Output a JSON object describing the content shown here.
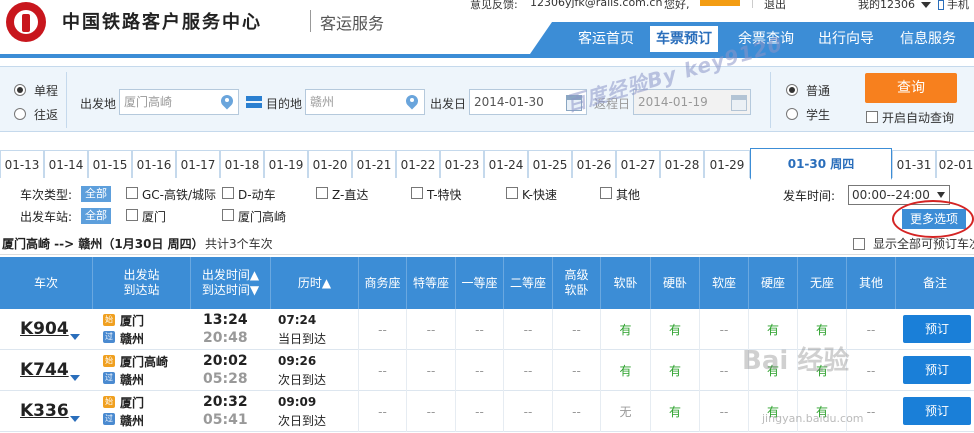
{
  "header": {
    "site_title": "中国铁路客户服务中心",
    "site_sub": "客运服务",
    "feedback": "意见反馈:",
    "feedback_email": "12306yjfk@rails.com.cn",
    "hello": "您好,",
    "logout": "退出",
    "my12306": "我的12306",
    "mobile": "手机"
  },
  "nav": [
    "客运首页",
    "车票预订",
    "余票查询",
    "出行向导",
    "信息服务"
  ],
  "search": {
    "one_way": "单程",
    "round_trip": "往返",
    "from_label": "出发地",
    "from_value": "厦门高崎",
    "to_label": "目的地",
    "to_value": "赣州",
    "date_label": "出发日",
    "date_value": "2014-01-30",
    "return_label": "返程日",
    "return_value": "2014-01-19",
    "normal": "普通",
    "student": "学生",
    "query": "查询",
    "auto_query": "开启自动查询"
  },
  "watermark": "百度经验By key9120",
  "dates": [
    "01-13",
    "01-14",
    "01-15",
    "01-16",
    "01-17",
    "01-18",
    "01-19",
    "01-20",
    "01-21",
    "01-22",
    "01-23",
    "01-24",
    "01-25",
    "01-26",
    "01-27",
    "01-28",
    "01-29",
    "01-30 周四",
    "01-31",
    "02-01"
  ],
  "filters": {
    "type_label": "车次类型:",
    "all": "全部",
    "types": [
      "GC-高铁/城际",
      "D-动车",
      "Z-直达",
      "T-特快",
      "K-快速",
      "其他"
    ],
    "station_label": "出发车站:",
    "stations": [
      "厦门",
      "厦门高崎"
    ],
    "depart_time_label": "发车时间:",
    "depart_time_value": "00:00--24:00",
    "more": "更多选项"
  },
  "route": {
    "text": "厦门高崎 --> 赣州（1月30日 周四）",
    "count": "共计3个车次",
    "show_all": "显示全部可预订车次"
  },
  "table": {
    "headers": [
      "车次",
      "出发站\n到达站",
      "出发时间▲\n到达时间▼",
      "历时▲",
      "商务座",
      "特等座",
      "一等座",
      "二等座",
      "高级\n软卧",
      "软卧",
      "硬卧",
      "软座",
      "硬座",
      "无座",
      "其他",
      "备注"
    ],
    "rows": [
      {
        "train": "K904",
        "from": "厦门",
        "to": "赣州",
        "dep": "13:24",
        "arr": "20:48",
        "dur": "07:24",
        "day": "当日到达",
        "seats": [
          "--",
          "--",
          "--",
          "--",
          "--",
          "有",
          "有",
          "--",
          "有",
          "有",
          "--"
        ],
        "book": "预订"
      },
      {
        "train": "K744",
        "from": "厦门高崎",
        "to": "赣州",
        "dep": "20:02",
        "arr": "05:28",
        "dur": "09:26",
        "day": "次日到达",
        "seats": [
          "--",
          "--",
          "--",
          "--",
          "--",
          "有",
          "有",
          "--",
          "有",
          "有",
          "--"
        ],
        "book": "预订"
      },
      {
        "train": "K336",
        "from": "厦门",
        "to": "赣州",
        "dep": "20:32",
        "arr": "05:41",
        "dur": "09:09",
        "day": "次日到达",
        "seats": [
          "--",
          "--",
          "--",
          "--",
          "--",
          "无",
          "有",
          "--",
          "有",
          "有",
          "--"
        ],
        "book": "预订"
      }
    ],
    "from_tag": "始",
    "to_tag": "过"
  },
  "baidu": {
    "mark": "Bai 经验",
    "url": "jingyan.baidu.com"
  }
}
